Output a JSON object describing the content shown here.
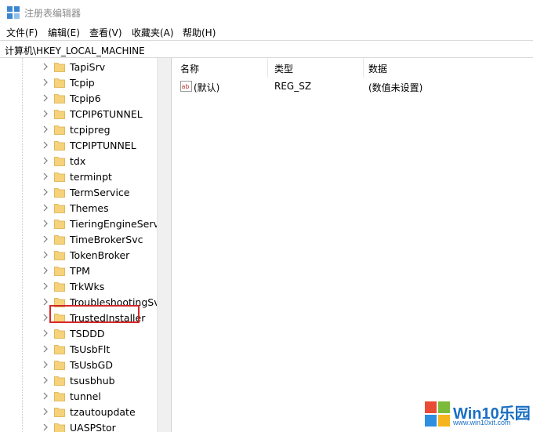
{
  "window": {
    "title": "注册表编辑器"
  },
  "menu": [
    "文件(F)",
    "编辑(E)",
    "查看(V)",
    "收藏夹(A)",
    "帮助(H)"
  ],
  "address": "计算机\\HKEY_LOCAL_MACHINE",
  "tree": {
    "items": [
      {
        "label": "TapiSrv",
        "expandable": true
      },
      {
        "label": "Tcpip",
        "expandable": true
      },
      {
        "label": "Tcpip6",
        "expandable": true
      },
      {
        "label": "TCPIP6TUNNEL",
        "expandable": true
      },
      {
        "label": "tcpipreg",
        "expandable": true
      },
      {
        "label": "TCPIPTUNNEL",
        "expandable": true
      },
      {
        "label": "tdx",
        "expandable": true
      },
      {
        "label": "terminpt",
        "expandable": true
      },
      {
        "label": "TermService",
        "expandable": true
      },
      {
        "label": "Themes",
        "expandable": true
      },
      {
        "label": "TieringEngineServic",
        "expandable": true
      },
      {
        "label": "TimeBrokerSvc",
        "expandable": true
      },
      {
        "label": "TokenBroker",
        "expandable": true,
        "highlighted": true
      },
      {
        "label": "TPM",
        "expandable": true
      },
      {
        "label": "TrkWks",
        "expandable": true
      },
      {
        "label": "TroubleshootingSvc",
        "expandable": true
      },
      {
        "label": "TrustedInstaller",
        "expandable": true
      },
      {
        "label": "TSDDD",
        "expandable": true
      },
      {
        "label": "TsUsbFlt",
        "expandable": true
      },
      {
        "label": "TsUsbGD",
        "expandable": true
      },
      {
        "label": "tsusbhub",
        "expandable": true
      },
      {
        "label": "tunnel",
        "expandable": true
      },
      {
        "label": "tzautoupdate",
        "expandable": true
      },
      {
        "label": "UASPStor",
        "expandable": true
      }
    ]
  },
  "list": {
    "columns": [
      "名称",
      "类型",
      "数据"
    ],
    "rows": [
      {
        "icon": "string-value-icon",
        "name": "(默认)",
        "type": "REG_SZ",
        "data": "(数值未设置)"
      }
    ]
  },
  "watermark": {
    "brand": "Win10乐园",
    "url": "www.win10xit.com"
  },
  "colors": {
    "highlight_box": "#d62828",
    "folder": "#f6d27a",
    "brand_blue": "#1a6fc3"
  }
}
